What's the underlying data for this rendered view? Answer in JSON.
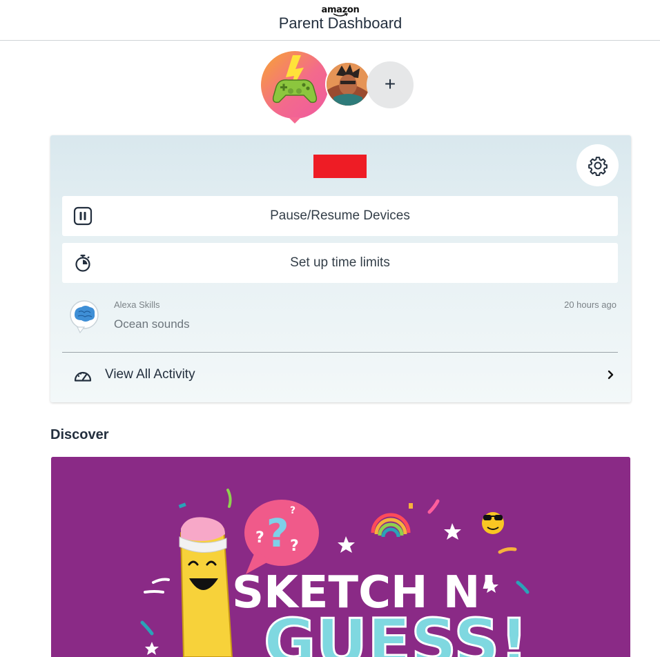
{
  "header": {
    "brand": "amazon",
    "title": "Parent Dashboard"
  },
  "profiles": {
    "add_label": "+"
  },
  "card": {
    "actions": [
      {
        "label": "Pause/Resume Devices",
        "icon": "pause-icon"
      },
      {
        "label": "Set up time limits",
        "icon": "stopwatch-icon"
      }
    ],
    "activity": {
      "source": "Alexa Skills",
      "title": "Ocean sounds",
      "time": "20 hours ago",
      "icon": "brain-icon"
    },
    "view_all_label": "View All Activity"
  },
  "discover": {
    "heading": "Discover",
    "banner": {
      "line1": "SKETCH N’",
      "line2": "GUESS!"
    }
  },
  "colors": {
    "redaction": "#ee1c25",
    "banner_bg": "#8a2a86",
    "card_top": "#d9e8ee",
    "text_primary": "#232f3e"
  }
}
